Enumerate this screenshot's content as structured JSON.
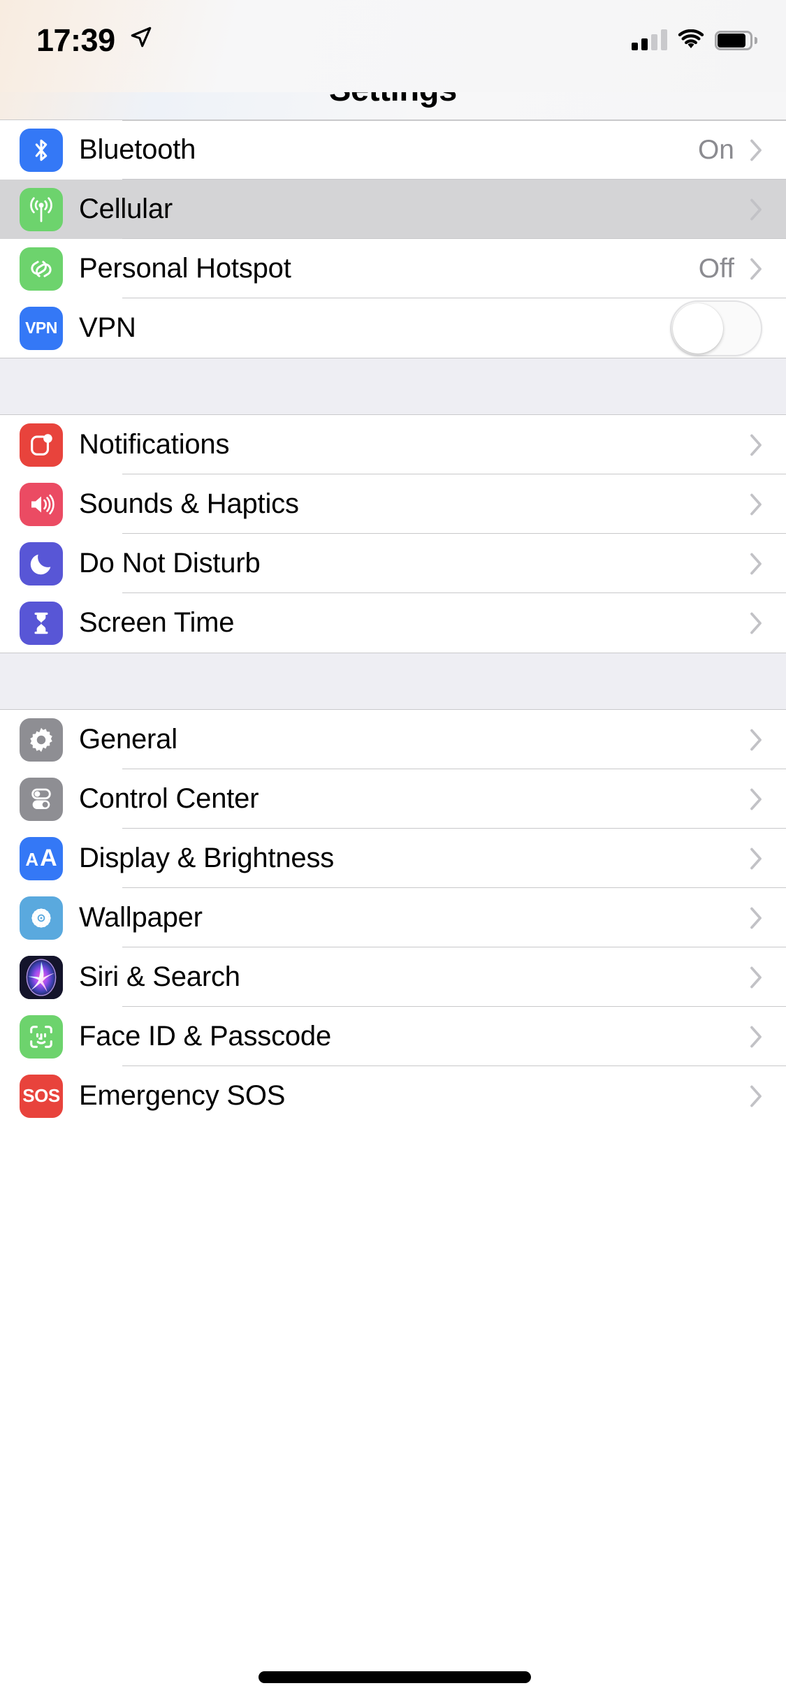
{
  "status_bar": {
    "time": "17:39",
    "location_icon": "location-arrow-icon",
    "cellular_bars_total": 4,
    "cellular_bars_filled": 2,
    "wifi_icon": "wifi-icon",
    "battery_icon": "battery-icon"
  },
  "header": {
    "title": "Settings"
  },
  "groups": [
    {
      "rows": [
        {
          "label": "Bluetooth",
          "value": "On",
          "icon": "bluetooth-icon",
          "icon_color": "#3478F6",
          "accessory": "chevron",
          "pressed": false
        },
        {
          "label": "Cellular",
          "value": "",
          "icon": "cellular-antenna-icon",
          "icon_color": "#6DD36D",
          "accessory": "chevron",
          "pressed": true
        },
        {
          "label": "Personal Hotspot",
          "value": "Off",
          "icon": "personal-hotspot-icon",
          "icon_color": "#6DD36D",
          "accessory": "chevron",
          "pressed": false
        },
        {
          "label": "VPN",
          "value": "",
          "icon": "vpn-icon",
          "icon_color": "#3478F6",
          "accessory": "toggle",
          "toggle_on": false,
          "pressed": false
        }
      ]
    },
    {
      "rows": [
        {
          "label": "Notifications",
          "value": "",
          "icon": "notifications-icon",
          "icon_color": "#E8433C",
          "accessory": "chevron",
          "pressed": false
        },
        {
          "label": "Sounds & Haptics",
          "value": "",
          "icon": "sounds-haptics-icon",
          "icon_color": "#EB4B63",
          "accessory": "chevron",
          "pressed": false
        },
        {
          "label": "Do Not Disturb",
          "value": "",
          "icon": "do-not-disturb-icon",
          "icon_color": "#5856D6",
          "accessory": "chevron",
          "pressed": false
        },
        {
          "label": "Screen Time",
          "value": "",
          "icon": "screen-time-icon",
          "icon_color": "#5856D6",
          "accessory": "chevron",
          "pressed": false
        }
      ]
    },
    {
      "rows": [
        {
          "label": "General",
          "value": "",
          "icon": "gear-icon",
          "icon_color": "#8E8E93",
          "accessory": "chevron",
          "pressed": false
        },
        {
          "label": "Control Center",
          "value": "",
          "icon": "control-center-icon",
          "icon_color": "#8E8E93",
          "accessory": "chevron",
          "pressed": false
        },
        {
          "label": "Display & Brightness",
          "value": "",
          "icon": "display-brightness-icon",
          "icon_color": "#3478F6",
          "accessory": "chevron",
          "pressed": false
        },
        {
          "label": "Wallpaper",
          "value": "",
          "icon": "wallpaper-icon",
          "icon_color": "#5AA9DE",
          "accessory": "chevron",
          "pressed": false
        },
        {
          "label": "Siri & Search",
          "value": "",
          "icon": "siri-icon",
          "icon_color": "#1C1C2E",
          "accessory": "chevron",
          "pressed": false
        },
        {
          "label": "Face ID & Passcode",
          "value": "",
          "icon": "face-id-icon",
          "icon_color": "#6DD36D",
          "accessory": "chevron",
          "pressed": false
        },
        {
          "label": "Emergency SOS",
          "value": "",
          "icon": "emergency-sos-icon",
          "icon_color": "#E8433C",
          "accessory": "chevron",
          "pressed": false
        }
      ]
    }
  ],
  "home_indicator": "home-indicator"
}
